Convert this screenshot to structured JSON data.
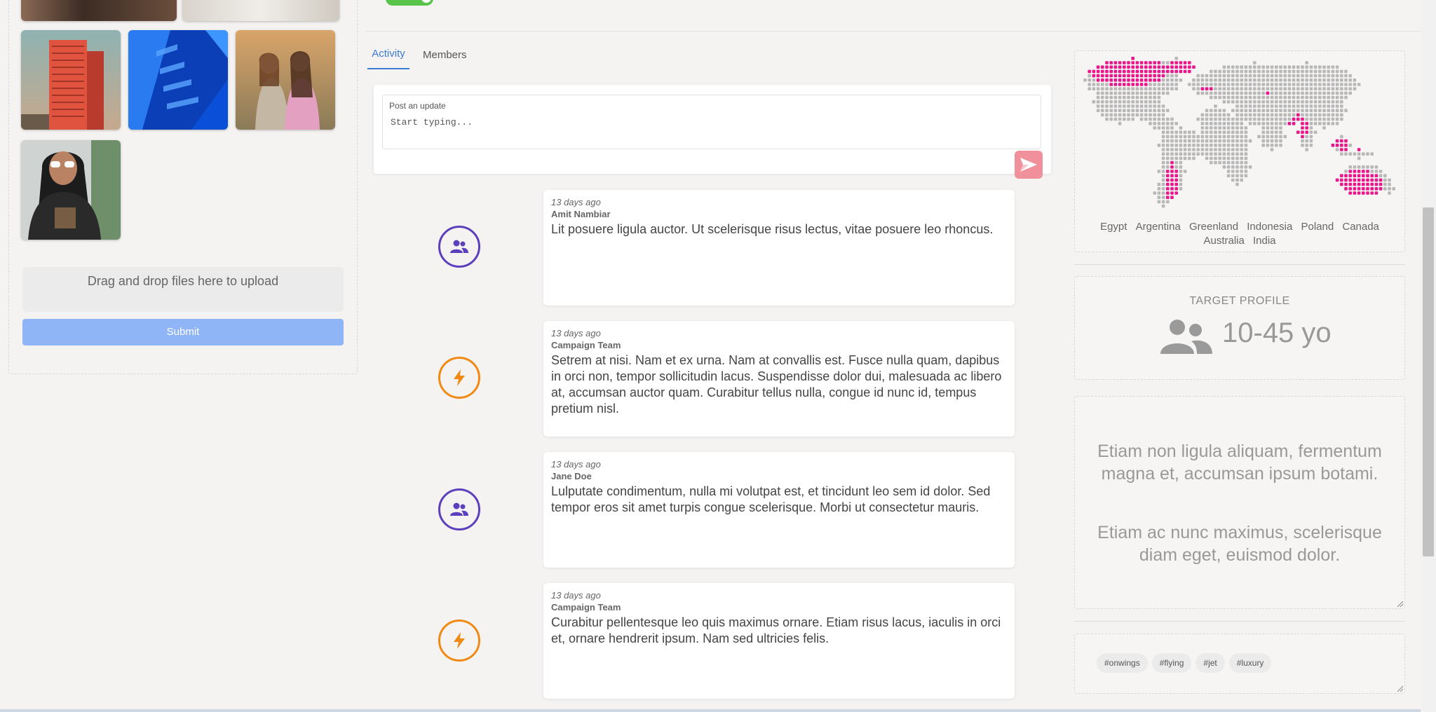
{
  "upload": {
    "dropzone_text": "Drag and drop files here to upload",
    "submit_label": "Submit"
  },
  "tabs": [
    {
      "label": "Activity",
      "active": true
    },
    {
      "label": "Members",
      "active": false
    }
  ],
  "post": {
    "label": "Post an update",
    "placeholder": "Start typing..."
  },
  "timeline": [
    {
      "icon": "group-icon",
      "time": "13 days ago",
      "author": "Amit Nambiar",
      "text": "Lit posuere ligula auctor. Ut scelerisque risus lectus, vitae posuere leo rhoncus."
    },
    {
      "icon": "bolt-icon",
      "time": "13 days ago",
      "author": "Campaign Team",
      "text": "Setrem at nisi. Nam et ex urna. Nam at convallis est. Fusce nulla quam, dapibus in orci non, tempor sollicitudin lacus. Suspendisse dolor dui, malesuada ac libero at, accumsan auctor quam. Curabitur tellus nulla, congue id nunc id, tempus pretium nisl."
    },
    {
      "icon": "group-icon",
      "time": "13 days ago",
      "author": "Jane Doe",
      "text": "Lulputate condimentum, nulla mi volutpat est, et tincidunt leo sem id dolor. Sed tempor eros sit amet turpis congue scelerisque. Morbi ut consectetur mauris."
    },
    {
      "icon": "bolt-icon",
      "time": "13 days ago",
      "author": "Campaign Team",
      "text": "Curabitur pellentesque leo quis maximus ornare. Etiam risus lacus, iaculis in orci et, ornare hendrerit ipsum. Nam sed ultricies felis."
    }
  ],
  "map": {
    "countries": [
      "Egypt",
      "Argentina",
      "Greenland",
      "Indonesia",
      "Poland",
      "Canada",
      "Australia",
      "India"
    ]
  },
  "target": {
    "label": "TARGET PROFILE",
    "value": "10-45 yo"
  },
  "description": {
    "p1": "Etiam non ligula aliquam, fermentum magna et, accumsan ipsum botami.",
    "p2": "Etiam ac nunc maximus, scelerisque diam eget, euismod dolor."
  },
  "tags": [
    "#onwings",
    "#flying",
    "#jet",
    "#luxury"
  ],
  "colors": {
    "accent": "#3a7bd5",
    "people_icon": "#5c3fbd",
    "bolt_icon": "#f08a15",
    "map_highlight": "#e8168a",
    "map_base": "#b8b8b8",
    "submit": "#8fb5f6",
    "send": "#f0909a"
  }
}
